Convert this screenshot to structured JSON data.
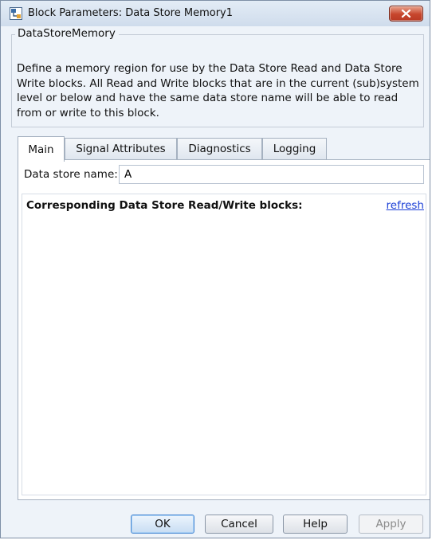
{
  "window": {
    "title": "Block Parameters: Data Store Memory1"
  },
  "group": {
    "label": "DataStoreMemory",
    "description": "Define a memory region for use by the Data Store Read and Data Store Write blocks. All Read and Write blocks that are in the current (sub)system level or below and have the same data store name will be able to read from or write to this block."
  },
  "tabs": [
    {
      "label": "Main",
      "active": true
    },
    {
      "label": "Signal Attributes",
      "active": false
    },
    {
      "label": "Diagnostics",
      "active": false
    },
    {
      "label": "Logging",
      "active": false
    }
  ],
  "main": {
    "data_store_name_label": "Data store name:",
    "data_store_name_value": "A",
    "blocks_heading": "Corresponding Data Store Read/Write blocks:",
    "refresh_label": "refresh"
  },
  "buttons": {
    "ok": "OK",
    "cancel": "Cancel",
    "help": "Help",
    "apply": "Apply"
  },
  "colors": {
    "accent": "#4c8ad3",
    "close_button": "#c7462d",
    "link": "#1a3ed6"
  },
  "icons": {
    "app": "simulink-block-icon",
    "close": "close-icon"
  }
}
